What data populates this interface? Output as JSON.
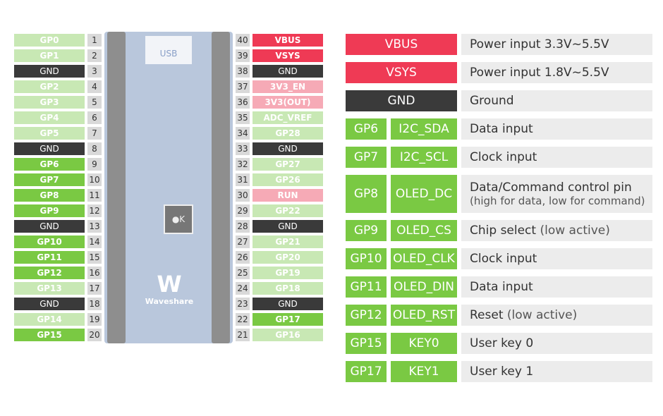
{
  "colors": {
    "light_green": "#c8e8b4",
    "green": "#7ac943",
    "gnd": "#3a3a3a",
    "power": "#ef3a55",
    "pink": "#f6aab6",
    "number_box": "#d9d9d9",
    "desc_bg": "#ececec"
  },
  "left_pins": [
    {
      "n": "1",
      "label": "GP0",
      "c": "lg"
    },
    {
      "n": "2",
      "label": "GP1",
      "c": "lg"
    },
    {
      "n": "3",
      "label": "GND",
      "c": "d"
    },
    {
      "n": "4",
      "label": "GP2",
      "c": "lg"
    },
    {
      "n": "5",
      "label": "GP3",
      "c": "lg"
    },
    {
      "n": "6",
      "label": "GP4",
      "c": "lg"
    },
    {
      "n": "7",
      "label": "GP5",
      "c": "lg"
    },
    {
      "n": "8",
      "label": "GND",
      "c": "d"
    },
    {
      "n": "9",
      "label": "GP6",
      "c": "g"
    },
    {
      "n": "10",
      "label": "GP7",
      "c": "g"
    },
    {
      "n": "11",
      "label": "GP8",
      "c": "g"
    },
    {
      "n": "12",
      "label": "GP9",
      "c": "g"
    },
    {
      "n": "13",
      "label": "GND",
      "c": "d"
    },
    {
      "n": "14",
      "label": "GP10",
      "c": "g"
    },
    {
      "n": "15",
      "label": "GP11",
      "c": "g"
    },
    {
      "n": "16",
      "label": "GP12",
      "c": "g"
    },
    {
      "n": "17",
      "label": "GP13",
      "c": "lg"
    },
    {
      "n": "18",
      "label": "GND",
      "c": "d"
    },
    {
      "n": "19",
      "label": "GP14",
      "c": "lg"
    },
    {
      "n": "20",
      "label": "GP15",
      "c": "g"
    }
  ],
  "right_pins": [
    {
      "n": "40",
      "label": "VBUS",
      "c": "r"
    },
    {
      "n": "39",
      "label": "VSYS",
      "c": "r"
    },
    {
      "n": "38",
      "label": "GND",
      "c": "d"
    },
    {
      "n": "37",
      "label": "3V3_EN",
      "c": "p"
    },
    {
      "n": "36",
      "label": "3V3(OUT)",
      "c": "p"
    },
    {
      "n": "35",
      "label": "ADC_VREF",
      "c": "lg"
    },
    {
      "n": "34",
      "label": "GP28",
      "c": "lg"
    },
    {
      "n": "33",
      "label": "GND",
      "c": "d"
    },
    {
      "n": "32",
      "label": "GP27",
      "c": "lg"
    },
    {
      "n": "31",
      "label": "GP26",
      "c": "lg"
    },
    {
      "n": "30",
      "label": "RUN",
      "c": "p"
    },
    {
      "n": "29",
      "label": "GP22",
      "c": "lg"
    },
    {
      "n": "28",
      "label": "GND",
      "c": "d"
    },
    {
      "n": "27",
      "label": "GP21",
      "c": "lg"
    },
    {
      "n": "26",
      "label": "GP20",
      "c": "lg"
    },
    {
      "n": "25",
      "label": "GP19",
      "c": "lg"
    },
    {
      "n": "24",
      "label": "GP18",
      "c": "lg"
    },
    {
      "n": "23",
      "label": "GND",
      "c": "d"
    },
    {
      "n": "22",
      "label": "GP17",
      "c": "g"
    },
    {
      "n": "21",
      "label": "GP16",
      "c": "lg"
    }
  ],
  "board": {
    "usb": "USB",
    "brand": "Waveshare",
    "logo": "W",
    "key_label": "●K"
  },
  "table": [
    {
      "pin": "VBUS",
      "func": "",
      "desc": "Power input 3.3V~5.5V",
      "note": "",
      "c": "r"
    },
    {
      "pin": "VSYS",
      "func": "",
      "desc": "Power input 1.8V~5.5V",
      "note": "",
      "c": "r"
    },
    {
      "pin": "GND",
      "func": "",
      "desc": "Ground",
      "note": "",
      "c": "d"
    },
    {
      "pin": "GP6",
      "func": "I2C_SDA",
      "desc": "Data input",
      "note": "",
      "c": "g"
    },
    {
      "pin": "GP7",
      "func": "I2C_SCL",
      "desc": "Clock input",
      "note": "",
      "c": "g"
    },
    {
      "pin": "GP8",
      "func": "OLED_DC",
      "desc": "Data/Command control pin",
      "note": "(high for data, low for command)",
      "c": "g",
      "tall": true
    },
    {
      "pin": "GP9",
      "func": "OLED_CS",
      "desc": "Chip select",
      "note": "(low active)",
      "c": "g",
      "inline": true
    },
    {
      "pin": "GP10",
      "func": "OLED_CLK",
      "desc": "Clock input",
      "note": "",
      "c": "g"
    },
    {
      "pin": "GP11",
      "func": "OLED_DIN",
      "desc": "Data input",
      "note": "",
      "c": "g"
    },
    {
      "pin": "GP12",
      "func": "OLED_RST",
      "desc": "Reset",
      "note": "(low active)",
      "c": "g",
      "inline": true
    },
    {
      "pin": "GP15",
      "func": "KEY0",
      "desc": "User key 0",
      "note": "",
      "c": "g"
    },
    {
      "pin": "GP17",
      "func": "KEY1",
      "desc": "User key 1",
      "note": "",
      "c": "g"
    }
  ]
}
